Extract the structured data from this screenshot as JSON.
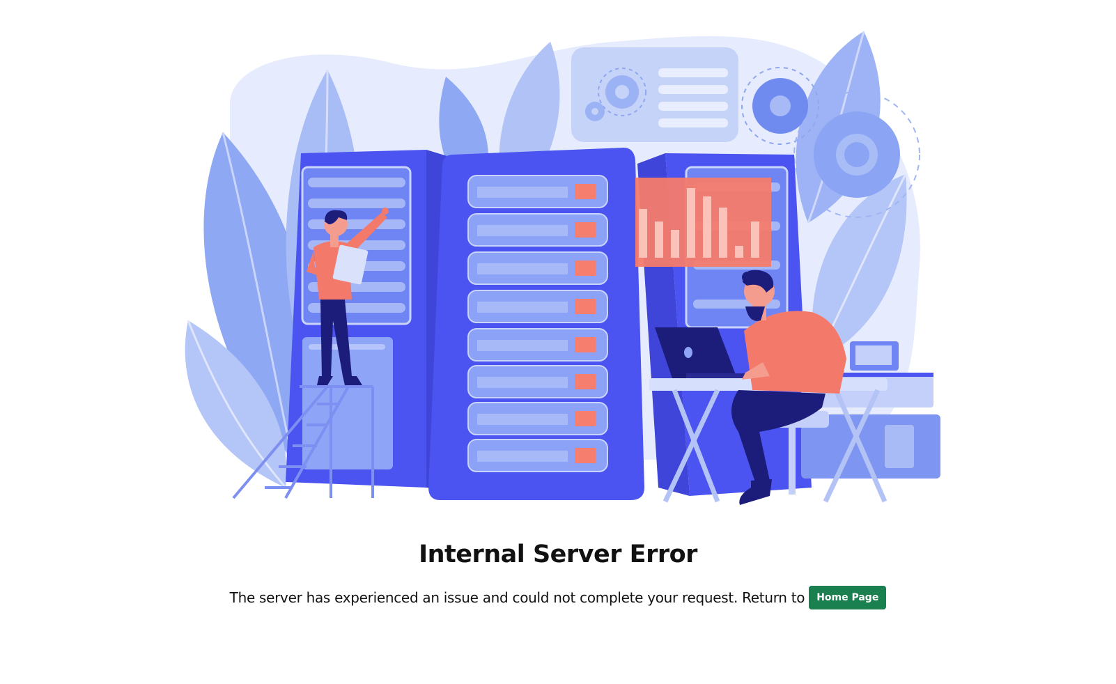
{
  "error": {
    "title": "Internal Server Error",
    "message": "The server has experienced an issue and could not complete your request. Return to",
    "home_button_label": "Home Page"
  },
  "illustration": {
    "subject": "server-room-maintenance",
    "colors": {
      "primary": "#4b53f0",
      "primary_dark": "#3f45d8",
      "light": "#b8c6f5",
      "lighter": "#e3e9fc",
      "accent": "#f37a6a",
      "navy": "#1c1c7a",
      "button": "#1a8050"
    }
  }
}
